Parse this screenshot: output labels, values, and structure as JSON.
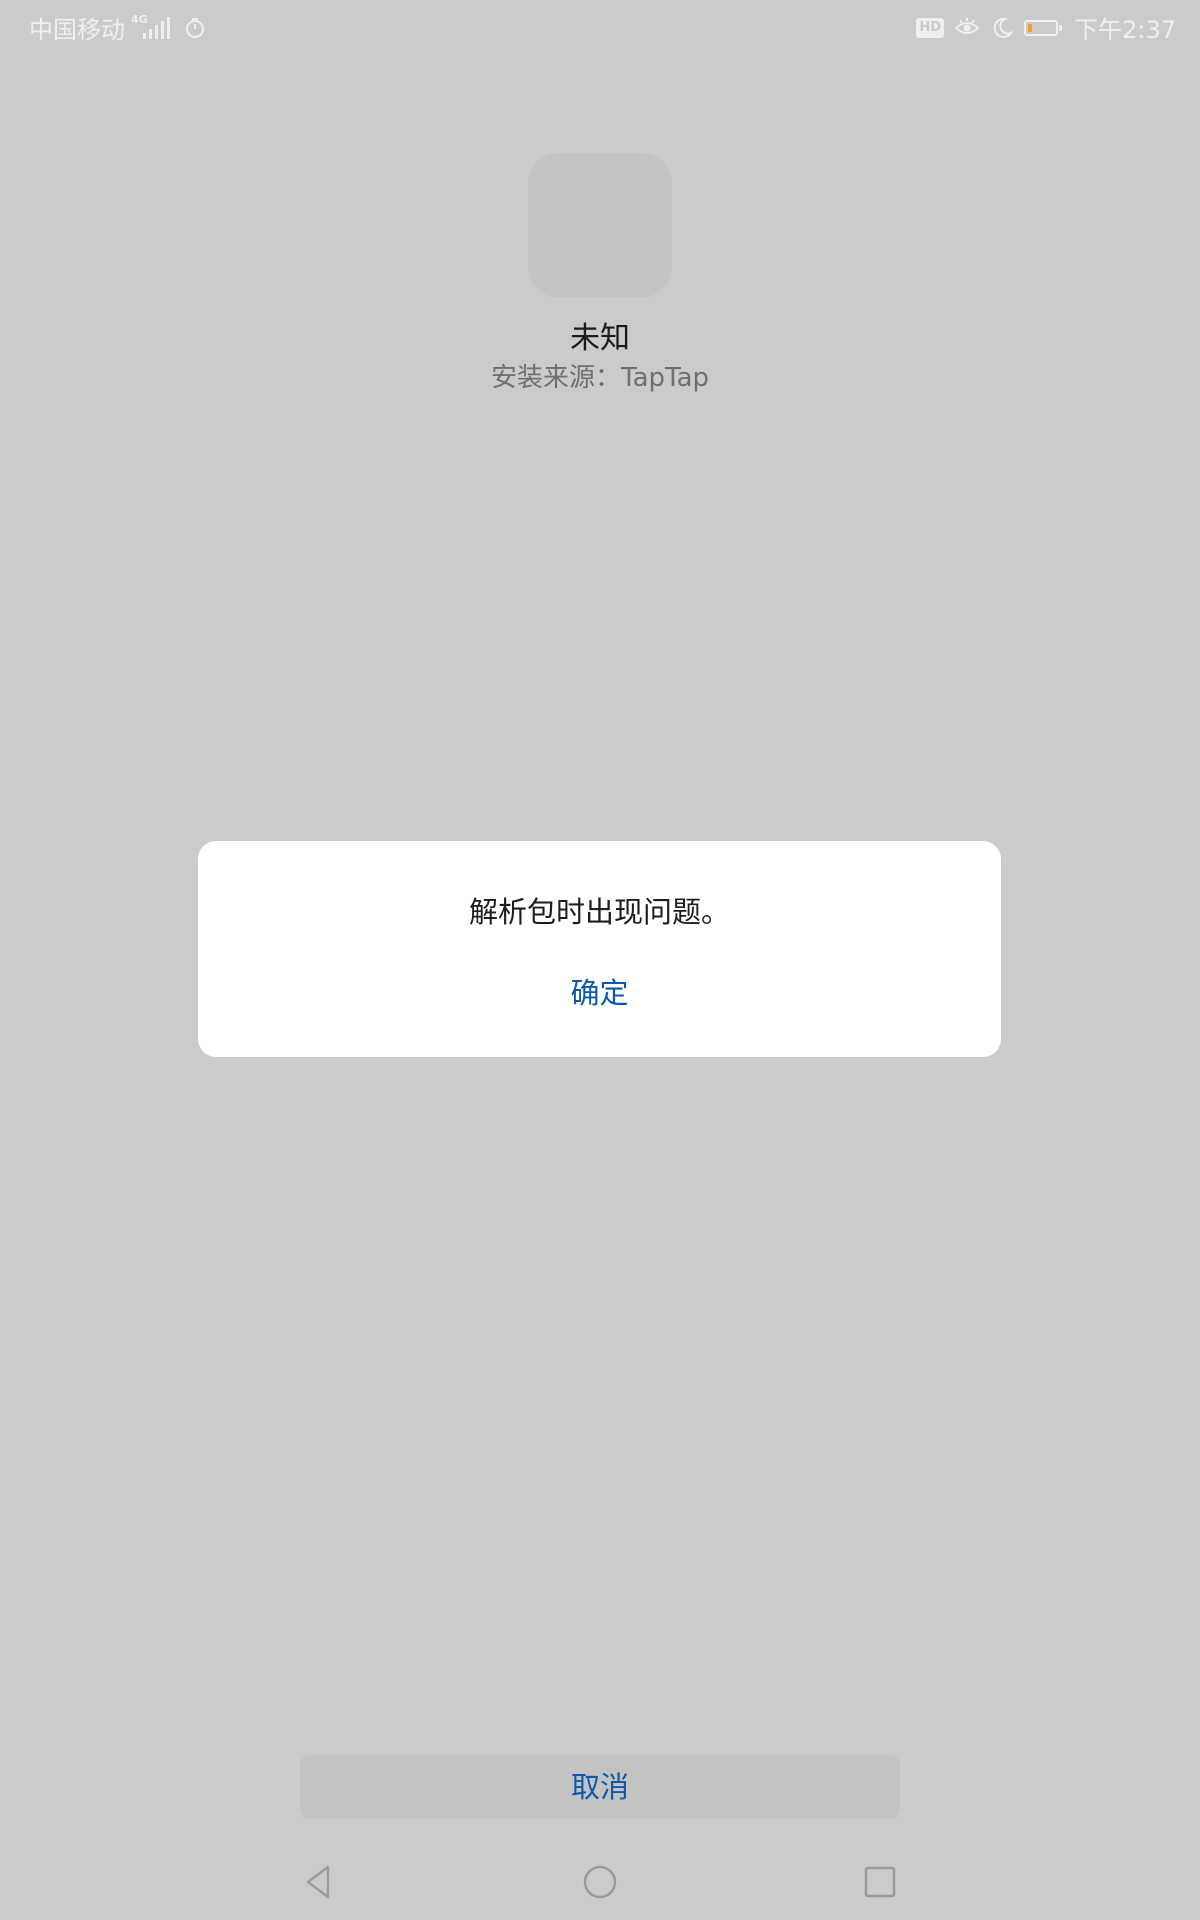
{
  "status_bar": {
    "carrier": "中国移动",
    "network": "4G",
    "hd_badge": "HD",
    "time": "下午2:37",
    "battery_level": 0.15,
    "icons": [
      "signal-icon",
      "timer-icon",
      "hd-icon",
      "eye-comfort-icon",
      "do-not-disturb-moon-icon",
      "battery-icon"
    ]
  },
  "app": {
    "name": "未知",
    "install_source": "安装来源：TapTap",
    "icon": "app-placeholder-icon"
  },
  "dialog": {
    "message": "解析包时出现问题。",
    "ok_label": "确定"
  },
  "footer": {
    "cancel_label": "取消"
  },
  "nav_bar": {
    "icons": [
      "back-icon",
      "home-icon",
      "recent-apps-icon"
    ]
  },
  "colors": {
    "background": "#cbcbcb",
    "accent": "#0b59a8",
    "dialog_bg": "#ffffff",
    "battery_low": "#f0a020"
  }
}
